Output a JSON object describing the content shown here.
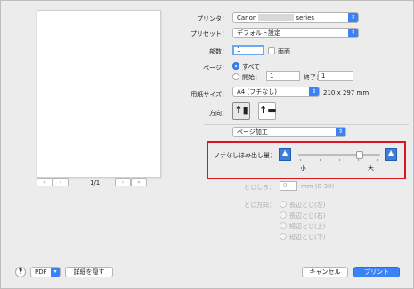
{
  "printer": {
    "label": "プリンタ：",
    "value_prefix": "Canon",
    "value_suffix": "series"
  },
  "preset": {
    "label": "プリセット：",
    "value": "デフォルト設定"
  },
  "copies": {
    "label": "部数：",
    "value": "1",
    "duplex_label": "両面"
  },
  "pages": {
    "label": "ページ：",
    "all_label": "すべて",
    "from_label": "開始：",
    "from_value": "1",
    "to_label": "終了：",
    "to_value": "1"
  },
  "paper_size": {
    "label": "用紙サイズ：",
    "value": "A4 (フチなし)",
    "dimensions": "210 x 297 mm"
  },
  "orientation": {
    "label": "方向："
  },
  "section": {
    "value": "ページ加工"
  },
  "borderless": {
    "label": "フチなしはみ出し量：",
    "small_label": "小",
    "large_label": "大",
    "level_fraction": 0.75
  },
  "margin": {
    "label": "とじしろ：",
    "value": "0",
    "unit": "mm (0-30)"
  },
  "binding": {
    "label": "とじ方向：",
    "options": [
      "長辺とじ(左)",
      "長辺とじ(右)",
      "短辺とじ(上)",
      "短辺とじ(下)"
    ]
  },
  "pager": {
    "page": "1/1"
  },
  "footer": {
    "help": "?",
    "pdf": "PDF",
    "hide_details": "詳細を隠す",
    "cancel": "キャンセル",
    "print": "プリント"
  }
}
